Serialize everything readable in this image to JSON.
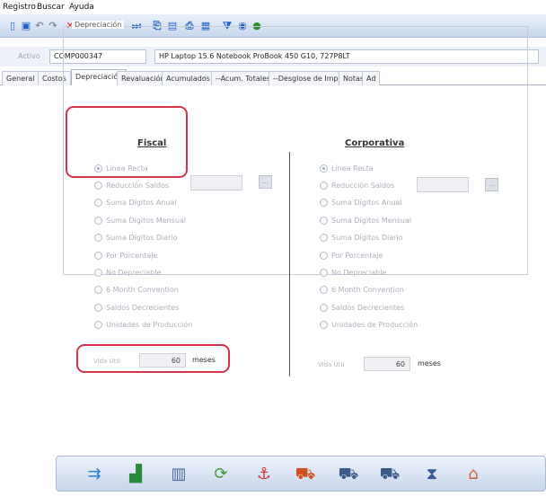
{
  "menu": [
    "Registro",
    "Buscar",
    "Ayuda"
  ],
  "toolbar_icons": [
    {
      "name": "new-icon",
      "glyph": "▯",
      "color": "blue"
    },
    {
      "name": "save-icon",
      "glyph": "▣",
      "color": "blue"
    },
    {
      "name": "undo-icon",
      "glyph": "↶",
      "color": "gray"
    },
    {
      "name": "redo-icon",
      "glyph": "↷",
      "color": "gray"
    },
    {
      "name": "delete-icon",
      "glyph": "✕",
      "color": "red"
    },
    {
      "name": "first-record-icon",
      "glyph": "⏮",
      "color": "blue"
    },
    {
      "name": "previous-record-icon",
      "glyph": "◂",
      "color": "blue"
    },
    {
      "name": "next-record-icon",
      "glyph": "▸",
      "color": "blue"
    },
    {
      "name": "last-record-icon",
      "glyph": "⏭",
      "color": "blue"
    },
    {
      "name": "copy-icon",
      "glyph": "⎘",
      "color": "blue"
    },
    {
      "name": "report-icon",
      "glyph": "▤",
      "color": "blue"
    },
    {
      "name": "print-icon",
      "glyph": "⎙",
      "color": "blue"
    },
    {
      "name": "grid-icon",
      "glyph": "▦",
      "color": "blue"
    },
    {
      "name": "filter-icon",
      "glyph": "⧩",
      "color": "blue"
    },
    {
      "name": "help-icon",
      "glyph": "◉",
      "color": "blue"
    },
    {
      "name": "globe-icon",
      "glyph": "●",
      "color": "green"
    }
  ],
  "activo": {
    "label": "Activo",
    "code": "COMP000347",
    "description": "HP Laptop 15.6 Notebook ProBook 450 G10, 727P8LT"
  },
  "tabs": [
    "General",
    "Costos",
    "Depreciación",
    "Revaluación",
    "Acumulados",
    "--Acum. Totales",
    "--Desglose de Impuesto",
    "Notas",
    "Ad"
  ],
  "active_tab": "Depreciación",
  "group_title": "Depreciación",
  "fiscal": {
    "title": "Fiscal",
    "options": [
      "Línea Recta",
      "Reducción Saldos",
      "Suma Dígitos Anual",
      "Suma Dígitos Mensual",
      "Suma Dígitos Diario",
      "Por Porcentaje",
      "No Depreciable",
      "6 Month Convention",
      "Saldos Decrecientes",
      "Unidades de Producción"
    ],
    "selected": "Línea Recta",
    "vida_label": "Vida Útil",
    "vida_value": "60",
    "vida_unit": "meses"
  },
  "corporativa": {
    "title": "Corporativa",
    "options": [
      "Línea Recta",
      "Reducción Saldos",
      "Suma Dígitos Anual",
      "Suma Dígitos Mensual",
      "Suma Dígitos Diario",
      "Por Porcentaje",
      "No Depreciable",
      "6 Month Convention",
      "Saldos Decrecientes",
      "Unidades de Producción"
    ],
    "selected": "Línea Recta",
    "vida_label": "Vida Útil",
    "vida_value": "60",
    "vida_unit": "meses"
  },
  "browse_button": "...",
  "bottom_icons": [
    {
      "name": "transfer-icon",
      "glyph": "⇉",
      "color": "#2a7fd4"
    },
    {
      "name": "chart-icon",
      "glyph": "▟",
      "color": "#2a8a3a"
    },
    {
      "name": "stock-icon",
      "glyph": "▥",
      "color": "#4a6a9a"
    },
    {
      "name": "refresh-icon",
      "glyph": "⟳",
      "color": "#3a9a3a"
    },
    {
      "name": "anchor-icon",
      "glyph": "⚓",
      "color": "#d03030"
    },
    {
      "name": "delivery-truck-icon",
      "glyph": "⛟",
      "color": "#d05020"
    },
    {
      "name": "move-in-icon",
      "glyph": "⛟",
      "color": "#3a5a8a"
    },
    {
      "name": "move-out-icon",
      "glyph": "⛟",
      "color": "#3a5a8a"
    },
    {
      "name": "hourglass-icon",
      "glyph": "⧗",
      "color": "#3a5a9a"
    },
    {
      "name": "archive-icon",
      "glyph": "⌂",
      "color": "#d06030"
    }
  ],
  "colors": {
    "highlight": "#d6334b",
    "toolbar_blue": "#1b5fc2"
  }
}
